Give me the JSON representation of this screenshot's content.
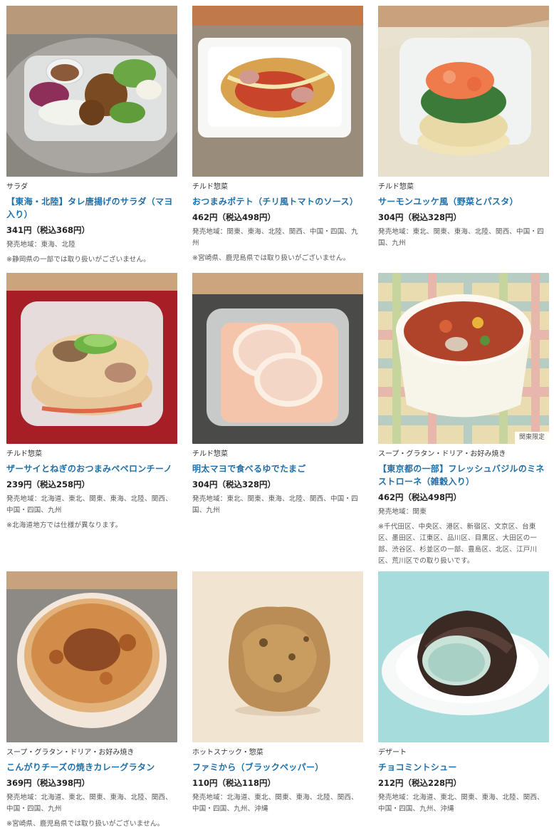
{
  "products": [
    {
      "category": "サラダ",
      "name": "【東海・北陸】タレ唐揚げのサラダ（マヨ入り）",
      "price": "341円（税込368円）",
      "area": "発売地域：東海、北陸",
      "note": "※静岡県の一部では取り扱いがございません。",
      "badge": ""
    },
    {
      "category": "チルド惣菜",
      "name": "おつまみポテト（チリ風トマトのソース）",
      "price": "462円（税込498円）",
      "area": "発売地域：関東、東海、北陸、関西、中国・四国、九州",
      "note": "※宮崎県、鹿児島県では取り扱いがございません。",
      "badge": ""
    },
    {
      "category": "チルド惣菜",
      "name": "サーモンユッケ風（野菜とパスタ）",
      "price": "304円（税込328円）",
      "area": "発売地域：東北、関東、東海、北陸、関西、中国・四国、九州",
      "note": "",
      "badge": ""
    },
    {
      "category": "チルド惣菜",
      "name": "ザーサイとねぎのおつまみペペロンチーノ",
      "price": "239円（税込258円）",
      "area": "発売地域：北海道、東北、関東、東海、北陸、関西、中国・四国、九州",
      "note": "※北海道地方では仕様が異なります。",
      "badge": ""
    },
    {
      "category": "チルド惣菜",
      "name": "明太マヨで食べるゆでたまご",
      "price": "304円（税込328円）",
      "area": "発売地域：東北、関東、東海、北陸、関西、中国・四国、九州",
      "note": "",
      "badge": ""
    },
    {
      "category": "スープ・グラタン・ドリア・お好み焼き",
      "name": "【東京都の一部】フレッシュバジルのミネストローネ（雑穀入り）",
      "price": "462円（税込498円）",
      "area": "発売地域：関東",
      "note": "※千代田区、中央区、港区、新宿区、文京区、台東区、墨田区、江東区、品川区、目黒区、大田区の一部、渋谷区、杉並区の一部、豊島区、北区、江戸川区、荒川区での取り扱いです。",
      "badge": "関東限定"
    },
    {
      "category": "スープ・グラタン・ドリア・お好み焼き",
      "name": "こんがりチーズの焼きカレーグラタン",
      "price": "369円（税込398円）",
      "area": "発売地域：北海道、東北、関東、東海、北陸、関西、中国・四国、九州",
      "note": "※宮崎県、鹿児島県では取り扱いがございません。",
      "badge": ""
    },
    {
      "category": "ホットスナック・惣菜",
      "name": "ファミから（ブラックペッパー）",
      "price": "110円（税込118円）",
      "area": "発売地域：北海道、東北、関東、東海、北陸、関西、中国・四国、九州、沖縄",
      "note": "",
      "badge": ""
    },
    {
      "category": "デザート",
      "name": "チョコミントシュー",
      "price": "212円（税込228円）",
      "area": "発売地域：北海道、東北、関東、東海、北陸、関西、中国・四国、九州、沖縄",
      "note": "",
      "badge": ""
    }
  ]
}
